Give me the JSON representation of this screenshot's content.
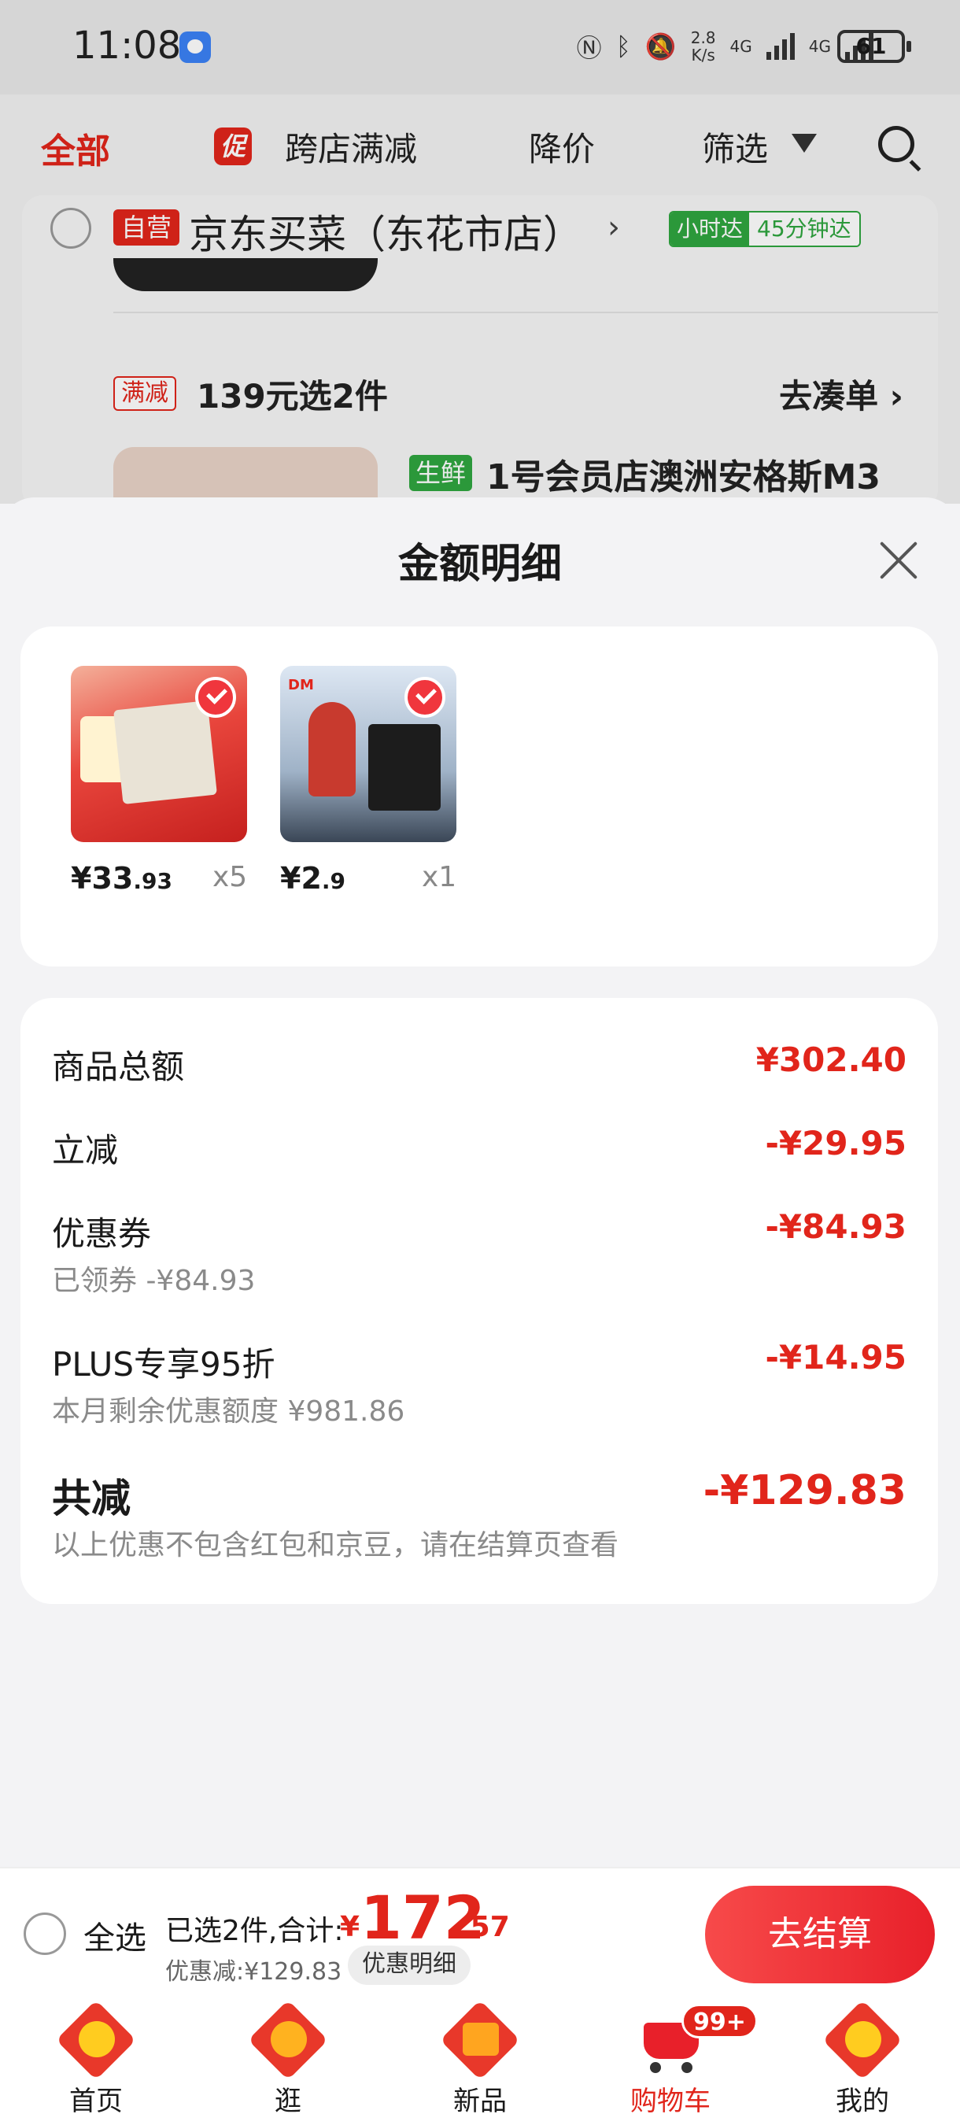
{
  "status_bar": {
    "time": "11:08",
    "net_speed_top": "2.8",
    "net_speed_bottom": "K/s",
    "signal1": "4G",
    "signal2": "4G",
    "battery": "61"
  },
  "filter_bar": {
    "all": "全部",
    "promo_badge": "促",
    "cross_store": "跨店满减",
    "price_drop": "降价",
    "filter": "筛选"
  },
  "store": {
    "badge": "自营",
    "name": "京东买菜（东花市店）",
    "arrow": "›",
    "delivery_tag": "小时达",
    "delivery_time": "45分钟达",
    "promo_badge": "满减",
    "promo_text": "139元选2件",
    "promo_link": "去凑单 ›",
    "product_badge": "生鲜",
    "product_title": "1号会员店澳洲安格斯M3"
  },
  "sheet": {
    "title": "金额明细",
    "items": [
      {
        "price_int": "¥33",
        "price_dec": ".93",
        "qty": "x5"
      },
      {
        "price_int": "¥2",
        "price_dec": ".9",
        "qty": "x1"
      }
    ],
    "rows": {
      "goods_total_label": "商品总额",
      "goods_total_value": "¥302.40",
      "instant_label": "立减",
      "instant_value": "-¥29.95",
      "coupon_label": "优惠券",
      "coupon_sub": "已领券 -¥84.93",
      "coupon_value": "-¥84.93",
      "plus_label": "PLUS专享95折",
      "plus_sub": "本月剩余优惠额度 ¥981.86",
      "plus_value": "-¥14.95",
      "total_label": "共减",
      "total_sub": "以上优惠不包含红包和京豆，请在结算页查看",
      "total_value": "-¥129.83"
    }
  },
  "checkout": {
    "select_all": "全选",
    "selected": "已选2件,合计:",
    "yen": "¥",
    "total_int": "172",
    "total_dec": ".57",
    "discount": "优惠减:¥129.83",
    "detail_button": "优惠明细",
    "pay_button": "去结算"
  },
  "tabbar": {
    "tabs": [
      {
        "label": "首页"
      },
      {
        "label": "逛"
      },
      {
        "label": "新品"
      },
      {
        "label": "购物车"
      },
      {
        "label": "我的"
      }
    ],
    "cart_badge": "99+",
    "active_color": "#e1251b"
  },
  "colors": {
    "accent": "#e1251b",
    "green": "#2fa53f"
  }
}
